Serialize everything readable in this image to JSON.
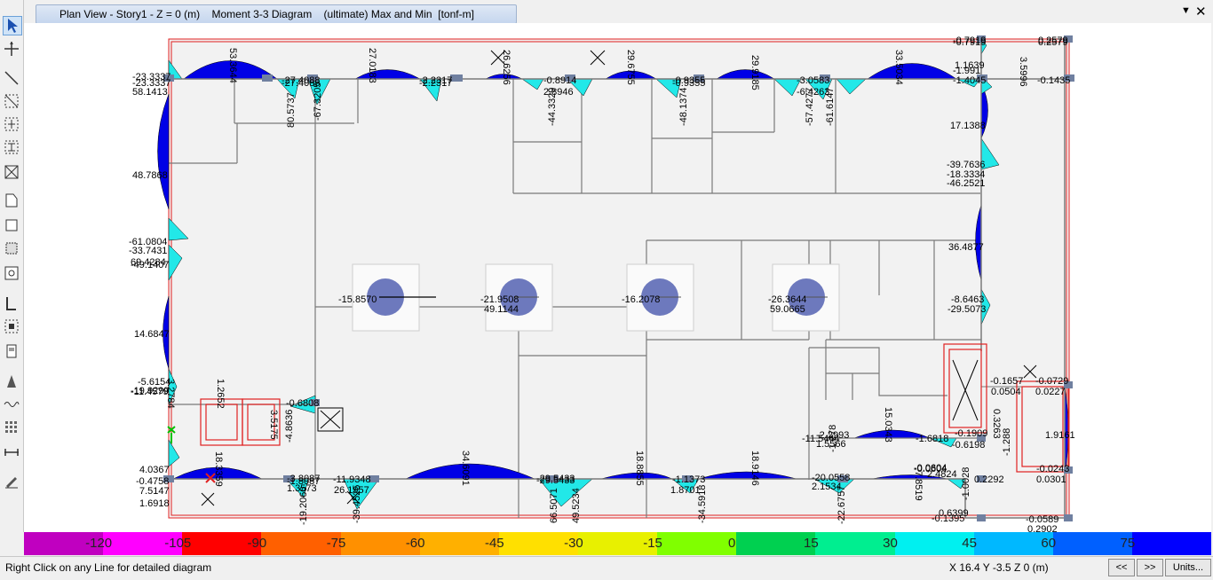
{
  "window": {
    "title": "Plan View - Story1 - Z = 0 (m)    Moment 3-3 Diagram    (ultimate) Max and Min  [tonf-m]",
    "menu_glyph": "▼",
    "close_glyph": "✕"
  },
  "toolbar": {
    "tools": [
      "pointer-icon",
      "reshape-icon",
      "draw-line-icon",
      "draw-rect-icon",
      "draw-grid-icon",
      "draw-brace-icon",
      "draw-cross-icon",
      "draw-area-icon",
      "draw-rect-area-icon",
      "draw-region-icon",
      "draw-point-icon",
      "draw-wall-icon",
      "draw-opening-icon",
      "draw-slab-icon",
      "draw-link-icon",
      "draw-spring-icon",
      "draw-grid-points-icon",
      "draw-dimension-icon",
      "draw-pencil-icon"
    ]
  },
  "plot_labels": [
    "-23.3337",
    "-23.3337",
    "58.1413",
    "53.3644",
    "-27.4088",
    "-27.4088",
    "80.5737",
    "-67.3205",
    "27.0183",
    "-2.2317",
    "-2.2317",
    "26.6256",
    "-0.8914",
    "2.8946",
    "-44.3329",
    "29.6755",
    "-0.9355",
    "-0.9355",
    "-48.1374",
    "29.9185",
    "-3.0583",
    "-6.4263",
    "-57.4277",
    "-61.6147",
    "33.5034",
    "-0.7919",
    "-0.7919",
    "0.2579",
    "0.2579",
    "1.1639",
    "-1.991",
    "-1.4045",
    "-0.1435",
    "3.5996",
    "17.1388",
    "48.7868",
    "-39.7636",
    "-18.3334",
    "-46.2521",
    "-61.0804",
    "-33.7431",
    "69.4284",
    "-49.1407",
    "36.4877",
    "-15.8570",
    "-21.9508",
    "49.1144",
    "-16.2078",
    "-26.3644",
    "59.0665",
    "-8.6463",
    "-29.5073",
    "14.6847",
    "-5.6154",
    "-19.9299",
    "-11.4579",
    "3.2784",
    "1.2652",
    "-0.6808",
    "-4.8636",
    "3.5175",
    "18.3359",
    "4.0367",
    "-0.4758",
    "7.5147",
    "1.6918",
    "-3.8087",
    "-1.8087",
    "1.3573",
    "-19.2066",
    "-11.9348",
    "26.1957",
    "-39.4525",
    "34.6091",
    "-29.5433",
    "-29.5433",
    "66.5071",
    "49.5234",
    "18.8855",
    "-1.1373",
    "1.8701",
    "-34.5918",
    "18.9146",
    "-20.0558",
    "2.1534",
    "-22.6757",
    "-11.5444",
    "-1.278",
    "1.5566",
    "-2.2993",
    "15.0343",
    "-1.6818",
    "7.8519",
    "-0.0604",
    "-0.0604",
    "2.4824",
    "-0.1909",
    "-0.6198",
    "0.3263",
    "-1.0028",
    "0.2292",
    "-0.1657",
    "0.0504",
    "-0.0729",
    "0.0227",
    "1.9161",
    "-1.288",
    "-0.0243",
    "0.0301",
    "0.6399",
    "-0.0589",
    "0.2902",
    "-0.1395"
  ],
  "colorbar": {
    "colors": [
      "#c000c0",
      "#ff00ff",
      "#ff0000",
      "#ff6000",
      "#ff9000",
      "#ffb000",
      "#ffe000",
      "#e8f000",
      "#80ff00",
      "#00d050",
      "#00ee90",
      "#00f0f0",
      "#00b8ff",
      "#0060ff",
      "#0000ff"
    ],
    "labels": [
      "-120",
      "-105",
      "-90",
      "-75",
      "-60",
      "-45",
      "-30",
      "-15",
      "0",
      "15",
      "30",
      "45",
      "60",
      "75"
    ]
  },
  "status": {
    "message": "Right Click on any Line for detailed diagram",
    "coordinates": "X 16.4  Y -3.5  Z 0 (m)",
    "prev_label": "<<",
    "next_label": ">>",
    "units_label": "Units..."
  }
}
